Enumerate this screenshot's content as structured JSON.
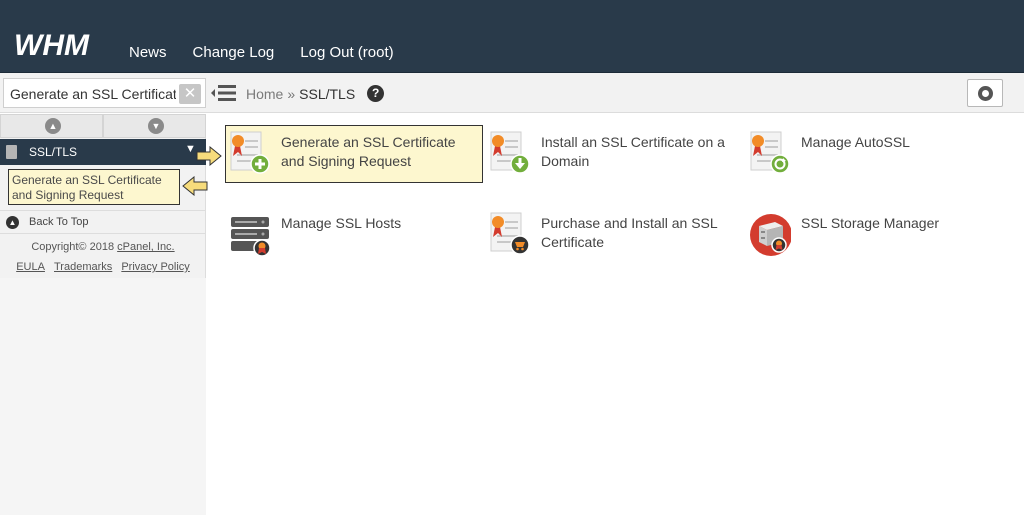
{
  "header": {
    "logo_text": "WHM",
    "nav": [
      "News",
      "Change Log",
      "Log Out (root)"
    ]
  },
  "search": {
    "value": "Generate an SSL Certificate and"
  },
  "breadcrumb": {
    "home": "Home",
    "separator": "»",
    "current": "SSL/TLS",
    "help": "?"
  },
  "sidebar": {
    "category": "SSL/TLS",
    "category_caret": "▼",
    "sub_item": "Generate an SSL Certificate and Signing Request",
    "back_to_top": "Back To Top",
    "copyright_prefix": "Copyright© 2018",
    "copyright_link": "cPanel, Inc.",
    "footer_links": [
      "EULA",
      "Trademarks",
      "Privacy Policy"
    ]
  },
  "tiles": [
    {
      "label": "Generate an SSL Certificate and Signing Request",
      "icon": "certificate-add-icon",
      "highlight": true
    },
    {
      "label": "Install an SSL Certificate on a Domain",
      "icon": "certificate-install-icon",
      "highlight": false
    },
    {
      "label": "Manage AutoSSL",
      "icon": "certificate-autossl-icon",
      "highlight": false
    },
    {
      "label": "Manage SSL Hosts",
      "icon": "server-ssl-icon",
      "highlight": false
    },
    {
      "label": "Purchase and Install an SSL Certificate",
      "icon": "certificate-purchase-icon",
      "highlight": false
    },
    {
      "label": "SSL Storage Manager",
      "icon": "storage-manager-icon",
      "highlight": false
    }
  ],
  "colors": {
    "header_bg": "#293a4a",
    "highlight_bg": "#fdf7cf",
    "arrow_fill": "#f7dc7c",
    "badge_orange": "#f28c28",
    "badge_red": "#d33c2e",
    "badge_green": "#72ae3c"
  }
}
